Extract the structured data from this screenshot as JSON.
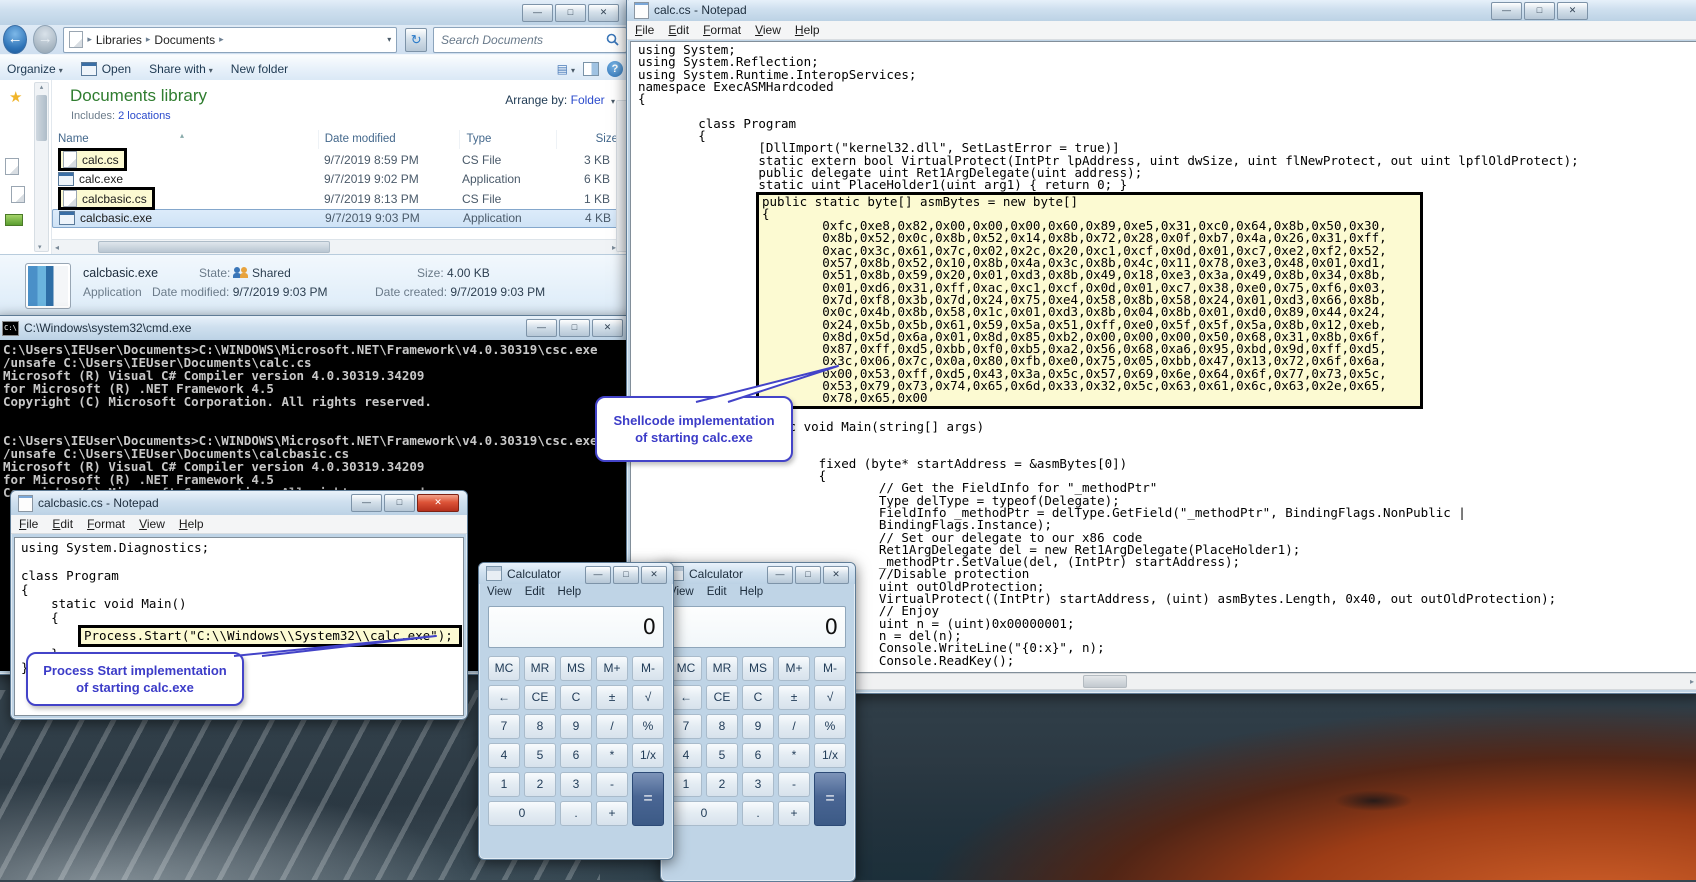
{
  "colors": {
    "annotation_highlight": "#fcfad2",
    "annotation_border": "#000000",
    "callout_blue": "#4343c8",
    "library_title_green": "#2f7d2f",
    "link_blue": "#2b4bcc"
  },
  "icons": {
    "minimize": "—",
    "maximize": "□",
    "close": "✕",
    "back": "←",
    "forward": "→",
    "refresh": "↻",
    "dropdown": "▾",
    "breadcrumb_arrow": "▸",
    "sort": "▴",
    "star": "★",
    "help": "?",
    "scroll_left": "◂",
    "scroll_right": "▸",
    "scroll_up": "▴",
    "scroll_down": "▾"
  },
  "explorer": {
    "breadcrumb": {
      "items": [
        "Libraries",
        "Documents"
      ]
    },
    "search": {
      "placeholder": "Search Documents"
    },
    "toolbar": {
      "organize": "Organize",
      "open": "Open",
      "share_with": "Share with",
      "new_folder": "New folder"
    },
    "library": {
      "title": "Documents library",
      "includes_label": "Includes:",
      "includes_link": "2 locations",
      "arrange_label": "Arrange by:",
      "arrange_value": "Folder"
    },
    "columns": {
      "name": "Name",
      "date": "Date modified",
      "type": "Type",
      "size": "Size"
    },
    "files": [
      {
        "name": "calc.cs",
        "date": "9/7/2019 8:59 PM",
        "type": "CS File",
        "size": "3 KB"
      },
      {
        "name": "calc.exe",
        "date": "9/7/2019 9:02 PM",
        "type": "Application",
        "size": "6 KB"
      },
      {
        "name": "calcbasic.cs",
        "date": "9/7/2019 8:13 PM",
        "type": "CS File",
        "size": "1 KB"
      },
      {
        "name": "calcbasic.exe",
        "date": "9/7/2019 9:03 PM",
        "type": "Application",
        "size": "4 KB"
      }
    ],
    "details": {
      "name": "calcbasic.exe",
      "type": "Application",
      "state_label": "State:",
      "state_value": "Shared",
      "modified_label": "Date modified:",
      "modified_value": "9/7/2019 9:03 PM",
      "size_label": "Size:",
      "size_value": "4.00 KB",
      "created_label": "Date created:",
      "created_value": "9/7/2019 9:03 PM"
    }
  },
  "cmd": {
    "title": "C:\\Windows\\system32\\cmd.exe",
    "output": "C:\\Users\\IEUser\\Documents>C:\\WINDOWS\\Microsoft.NET\\Framework\\v4.0.30319\\csc.exe\n/unsafe C:\\Users\\IEUser\\Documents\\calc.cs\nMicrosoft (R) Visual C# Compiler version 4.0.30319.34209\nfor Microsoft (R) .NET Framework 4.5\nCopyright (C) Microsoft Corporation. All rights reserved.\n\n\nC:\\Users\\IEUser\\Documents>C:\\WINDOWS\\Microsoft.NET\\Framework\\v4.0.30319\\csc.exe\n/unsafe C:\\Users\\IEUser\\Documents\\calcbasic.cs\nMicrosoft (R) Visual C# Compiler version 4.0.30319.34209\nfor Microsoft (R) .NET Framework 4.5\nCopyright (C) Microsoft Corporation. All rights reserved."
  },
  "notepad_calc": {
    "title": "calc.cs - Notepad",
    "menu": [
      "File",
      "Edit",
      "Format",
      "View",
      "Help"
    ],
    "code_before": "using System;\nusing System.Reflection;\nusing System.Runtime.InteropServices;\nnamespace ExecASMHardcoded\n{\n\n        class Program\n        {\n                [DllImport(\"kernel32.dll\", SetLastError = true)]\n                static extern bool VirtualProtect(IntPtr lpAddress, uint dwSize, uint flNewProtect, out uint lpflOldProtect);\n                public delegate uint Ret1ArgDelegate(uint address);\n                static uint PlaceHolder1(uint arg1) { return 0; }",
    "code_highlight": "public static byte[] asmBytes = new byte[]\n{\n        0xfc,0xe8,0x82,0x00,0x00,0x00,0x60,0x89,0xe5,0x31,0xc0,0x64,0x8b,0x50,0x30,\n        0x8b,0x52,0x0c,0x8b,0x52,0x14,0x8b,0x72,0x28,0x0f,0xb7,0x4a,0x26,0x31,0xff,\n        0xac,0x3c,0x61,0x7c,0x02,0x2c,0x20,0xc1,0xcf,0x0d,0x01,0xc7,0xe2,0xf2,0x52,\n        0x57,0x8b,0x52,0x10,0x8b,0x4a,0x3c,0x8b,0x4c,0x11,0x78,0xe3,0x48,0x01,0xd1,\n        0x51,0x8b,0x59,0x20,0x01,0xd3,0x8b,0x49,0x18,0xe3,0x3a,0x49,0x8b,0x34,0x8b,\n        0x01,0xd6,0x31,0xff,0xac,0xc1,0xcf,0x0d,0x01,0xc7,0x38,0xe0,0x75,0xf6,0x03,\n        0x7d,0xf8,0x3b,0x7d,0x24,0x75,0xe4,0x58,0x8b,0x58,0x24,0x01,0xd3,0x66,0x8b,\n        0x0c,0x4b,0x8b,0x58,0x1c,0x01,0xd3,0x8b,0x04,0x8b,0x01,0xd0,0x89,0x44,0x24,\n        0x24,0x5b,0x5b,0x61,0x59,0x5a,0x51,0xff,0xe0,0x5f,0x5f,0x5a,0x8b,0x12,0xeb,\n        0x8d,0x5d,0x6a,0x01,0x8d,0x85,0xb2,0x00,0x00,0x00,0x50,0x68,0x31,0x8b,0x6f,\n        0x87,0xff,0xd5,0xbb,0xf0,0xb5,0xa2,0x56,0x68,0xa6,0x95,0xbd,0x9d,0xff,0xd5,\n        0x3c,0x06,0x7c,0x0a,0x80,0xfb,0xe0,0x75,0x05,0xbb,0x47,0x13,0x72,0x6f,0x6a,\n        0x00,0x53,0xff,0xd5,0x43,0x3a,0x5c,0x57,0x69,0x6e,0x64,0x6f,0x77,0x73,0x5c,\n        0x53,0x79,0x73,0x74,0x65,0x6d,0x33,0x32,0x5c,0x63,0x61,0x6c,0x63,0x2e,0x65,\n        0x78,0x65,0x00",
    "code_after": "              };\n        unsafe static void Main(string[] args)\n        {\n\n                        fixed (byte* startAddress = &asmBytes[0])\n                        {\n                                // Get the FieldInfo for \"_methodPtr\"\n                                Type delType = typeof(Delegate);\n                                FieldInfo _methodPtr = delType.GetField(\"_methodPtr\", BindingFlags.NonPublic |\n                                BindingFlags.Instance);\n                                // Set our delegate to our x86 code\n                                Ret1ArgDelegate del = new Ret1ArgDelegate(PlaceHolder1);\n                                _methodPtr.SetValue(del, (IntPtr) startAddress);\n                                //Disable protection\n                                uint outOldProtection;\n                                VirtualProtect((IntPtr) startAddress, (uint) asmBytes.Length, 0x40, out outOldProtection);\n                                // Enjoy\n                                uint n = (uint)0x00000001;\n                                n = del(n);\n                                Console.WriteLine(\"{0:x}\", n);\n                                Console.ReadKey();"
  },
  "notepad_calcbasic": {
    "title": "calcbasic.cs - Notepad",
    "menu": [
      "File",
      "Edit",
      "Format",
      "View",
      "Help"
    ],
    "code_before": "using System.Diagnostics;\n\nclass Program\n{\n    static void Main()\n    {",
    "code_highlight": "Process.Start(\"C:\\\\Windows\\\\System32\\\\calc.exe\");",
    "code_after": "    }\n}"
  },
  "calculator": {
    "title": "Calculator",
    "menu": [
      "View",
      "Edit",
      "Help"
    ],
    "display": "0",
    "keys": [
      "MC",
      "MR",
      "MS",
      "M+",
      "M-",
      "←",
      "CE",
      "C",
      "±",
      "√",
      "7",
      "8",
      "9",
      "/",
      "%",
      "4",
      "5",
      "6",
      "*",
      "1/x",
      "1",
      "2",
      "3",
      "-",
      "=",
      "0",
      ".",
      "+"
    ]
  },
  "callouts": {
    "shellcode": {
      "line1": "Shellcode implementation",
      "line2": "of starting calc.exe"
    },
    "process": {
      "line1": "Process Start implementation",
      "line2": "of starting calc.exe"
    }
  }
}
